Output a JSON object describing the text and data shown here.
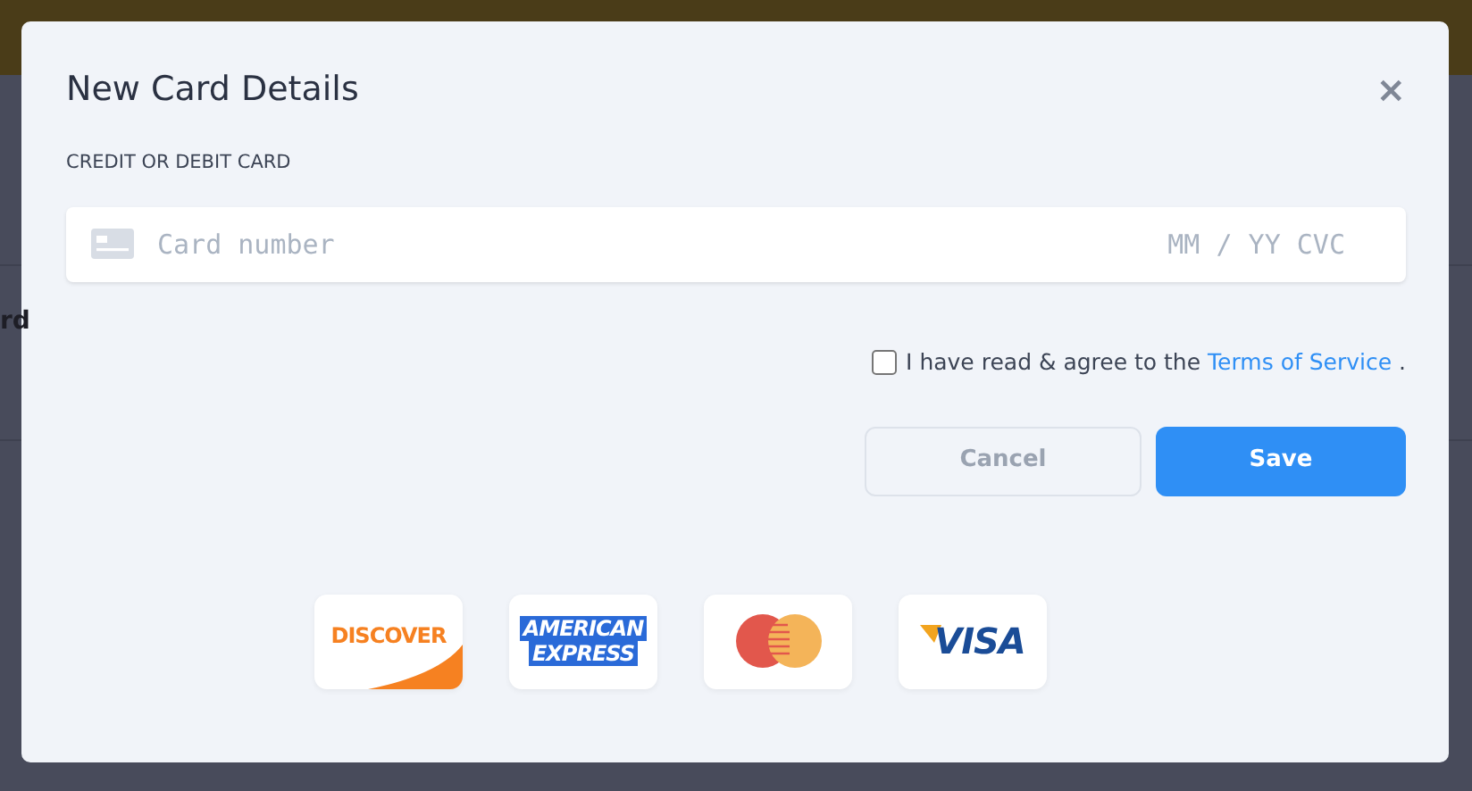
{
  "background": {
    "partial_text": "rd"
  },
  "modal": {
    "title": "New Card Details",
    "close": "×",
    "section_label": "CREDIT OR DEBIT CARD",
    "card_field": {
      "number_placeholder": "Card number",
      "expiry_placeholder": "MM / YY CVC"
    },
    "agreement": {
      "checked": false,
      "text": "I have read & agree to the",
      "link": "Terms of Service",
      "end": "."
    },
    "buttons": [
      {
        "label": "Cancel",
        "kind": "secondary"
      },
      {
        "label": "Save",
        "kind": "primary"
      }
    ],
    "card_logos": [
      {
        "kind": "discover",
        "texts": [
          "DISCOVER"
        ]
      },
      {
        "kind": "amex",
        "texts": [
          "AMERICAN",
          "EXPRESS"
        ]
      },
      {
        "kind": "mastercard"
      },
      {
        "kind": "visa",
        "texts": [
          "VISA"
        ]
      }
    ]
  }
}
